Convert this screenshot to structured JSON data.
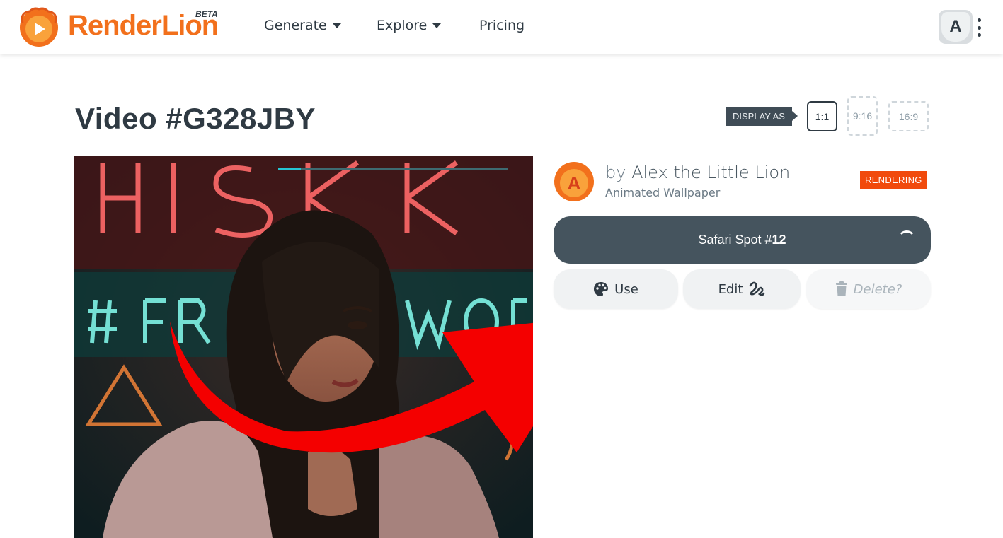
{
  "app": {
    "brand": "RenderLion",
    "beta": "BETA"
  },
  "nav": {
    "items": [
      {
        "label": "Generate",
        "has_caret": true
      },
      {
        "label": "Explore",
        "has_caret": true
      },
      {
        "label": "Pricing",
        "has_caret": false
      }
    ],
    "user_initial": "A"
  },
  "page": {
    "title": "Video #G328JBY",
    "display_as_label": "DISPLAY AS",
    "ratios": [
      {
        "label": "1:1",
        "active": true
      },
      {
        "label": "9:16",
        "active": false
      },
      {
        "label": "16:9",
        "active": false
      }
    ]
  },
  "player": {
    "progress_fraction": 0.1
  },
  "details": {
    "by": "by",
    "author_name": "Alex the Little Lion",
    "author_initial": "A",
    "subtitle": "Animated Wallpaper",
    "status_badge": "RENDERING",
    "video_title_prefix": "Safari Spot #",
    "video_title_number": "12",
    "actions": {
      "use": "Use",
      "edit": "Edit",
      "delete": "Delete?"
    }
  },
  "colors": {
    "brand_orange": "#f2701c",
    "dark": "#2f3a43",
    "badge": "#f14a0c",
    "progress": "#26c4d2",
    "arrow": "#f40000"
  },
  "icons": [
    "play-logo-icon",
    "caret-down-icon",
    "kebab-menu-icon",
    "spinner-icon",
    "palette-icon",
    "scribble-icon",
    "trash-icon"
  ]
}
